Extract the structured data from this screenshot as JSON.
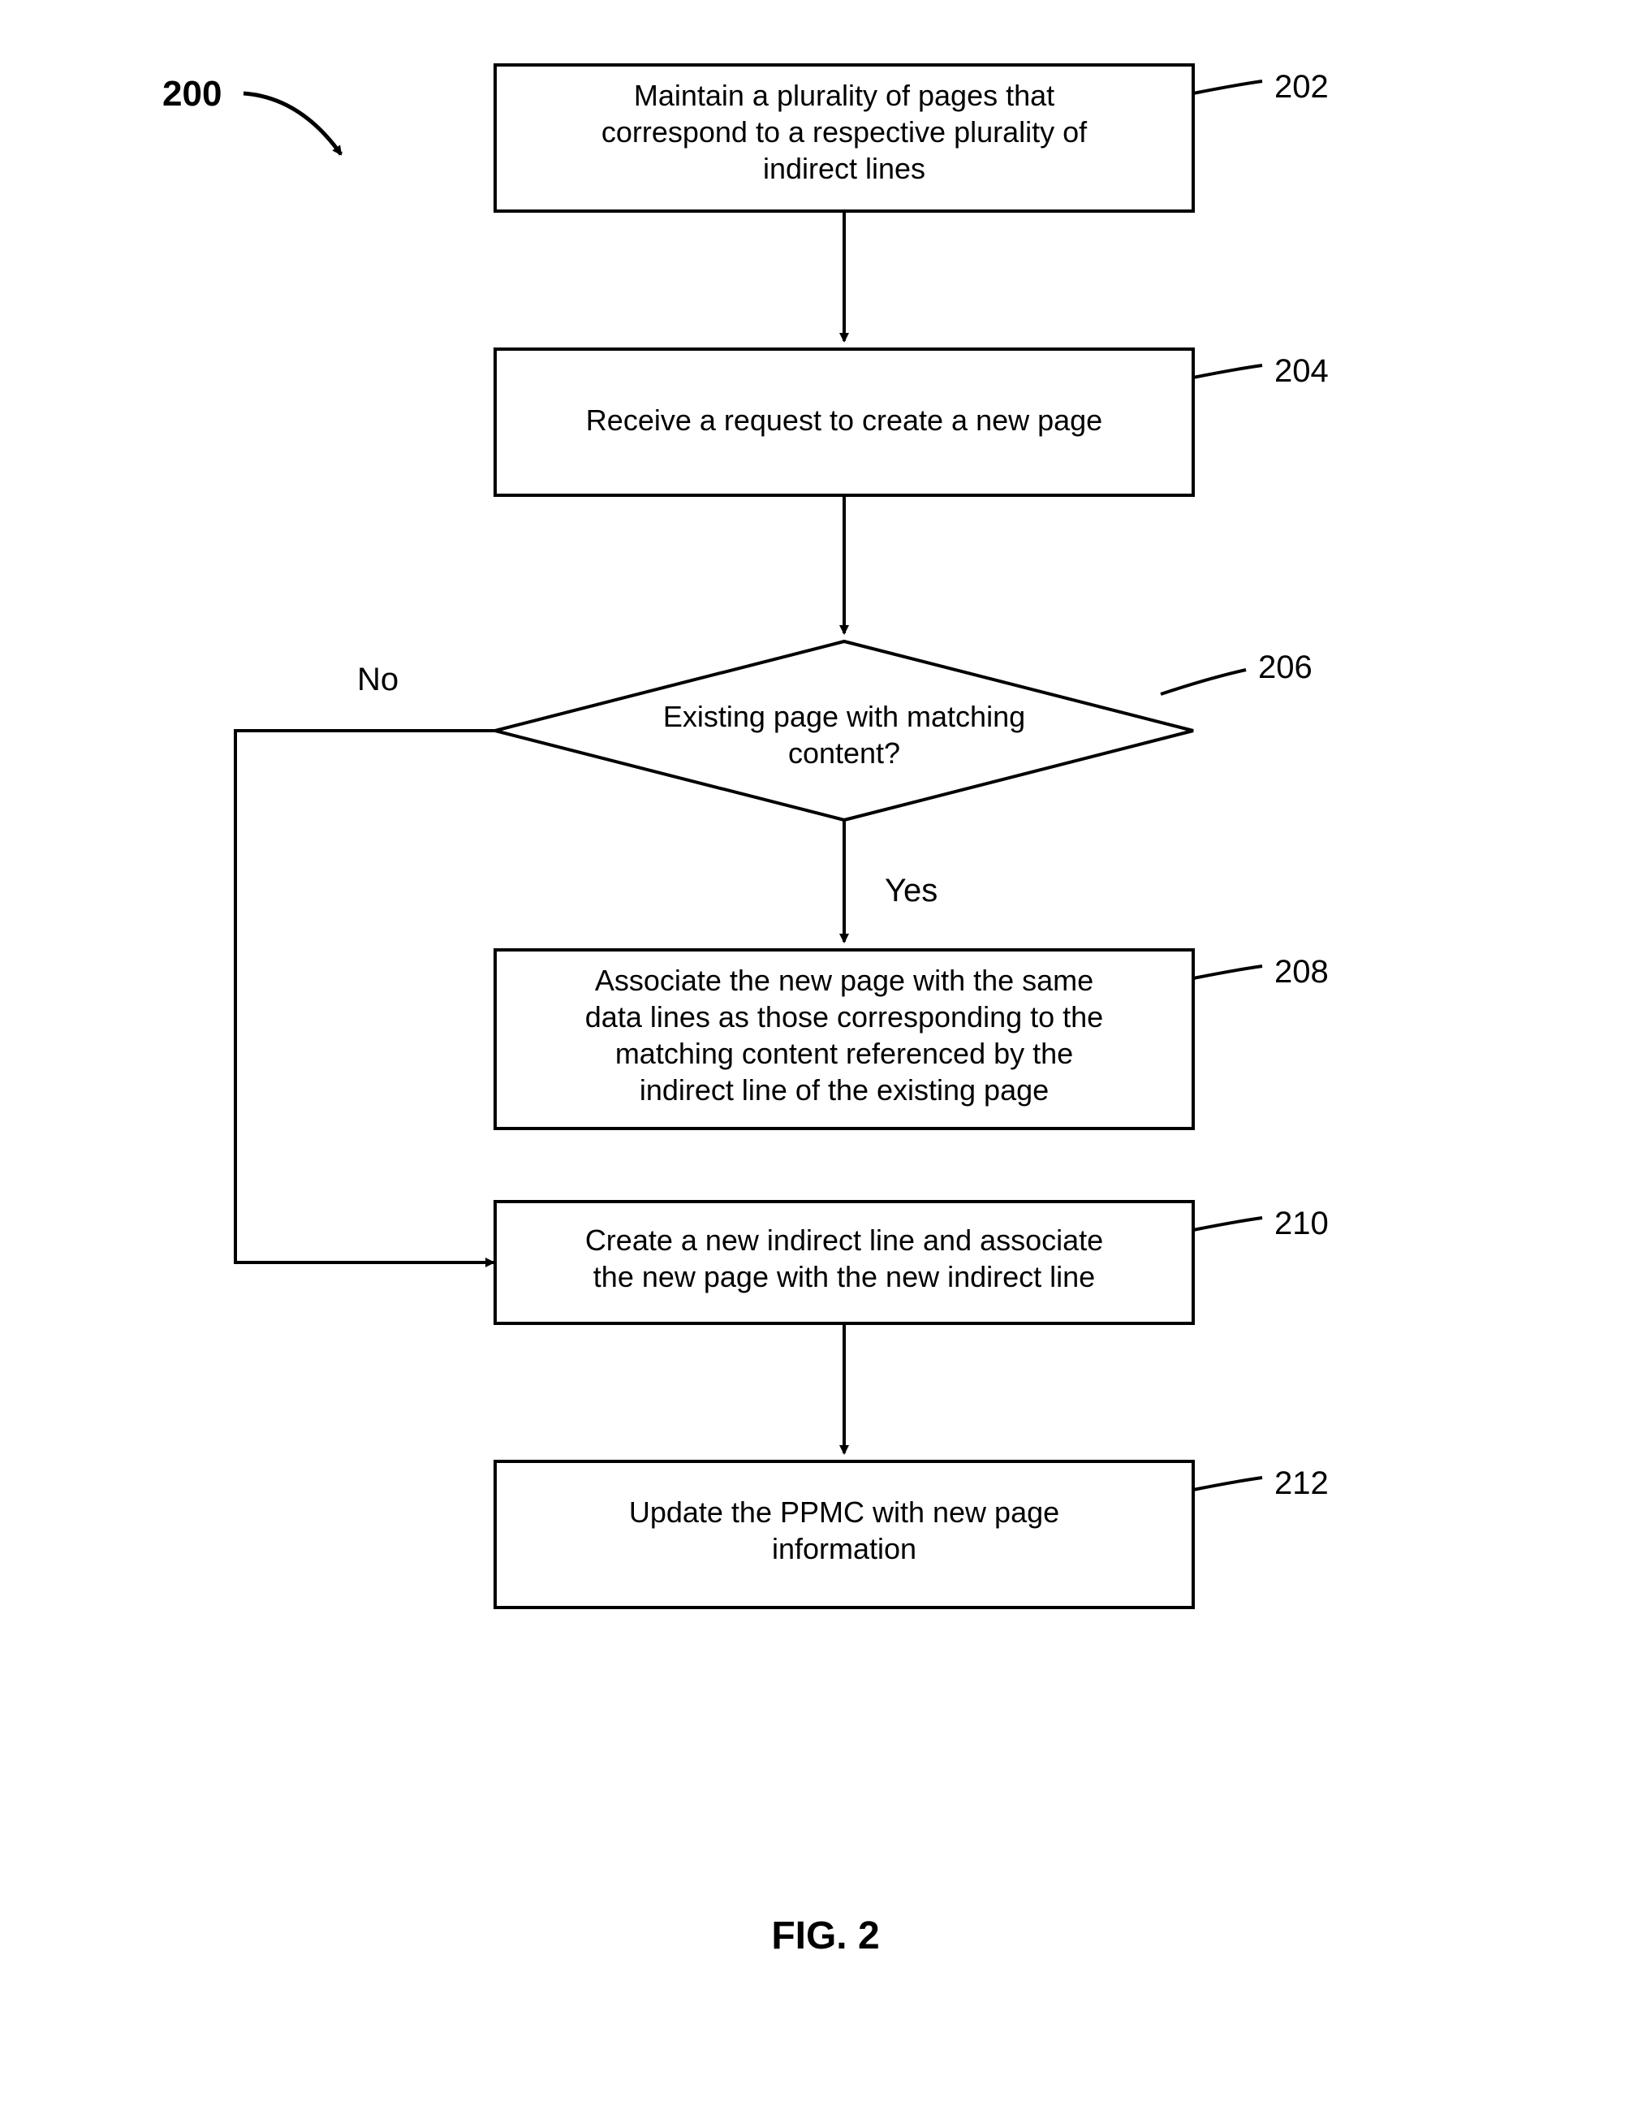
{
  "figure_title": "FIG. 2",
  "diagram_ref": "200",
  "nodes": {
    "n202": {
      "ref": "202",
      "lines": [
        "Maintain a plurality of pages that",
        "correspond to a respective plurality of",
        "indirect lines"
      ]
    },
    "n204": {
      "ref": "204",
      "lines": [
        "Receive a request to create a new page"
      ]
    },
    "n206": {
      "ref": "206",
      "lines": [
        "Existing page with matching",
        "content?"
      ]
    },
    "n208": {
      "ref": "208",
      "lines": [
        "Associate the new page with the same",
        "data lines as those corresponding to the",
        "matching content referenced by the",
        "indirect line of the existing page"
      ]
    },
    "n210": {
      "ref": "210",
      "lines": [
        "Create a new indirect line and associate",
        "the new page with the new indirect line"
      ]
    },
    "n212": {
      "ref": "212",
      "lines": [
        "Update the PPMC with new page",
        "information"
      ]
    }
  },
  "edges": {
    "no": "No",
    "yes": "Yes"
  }
}
